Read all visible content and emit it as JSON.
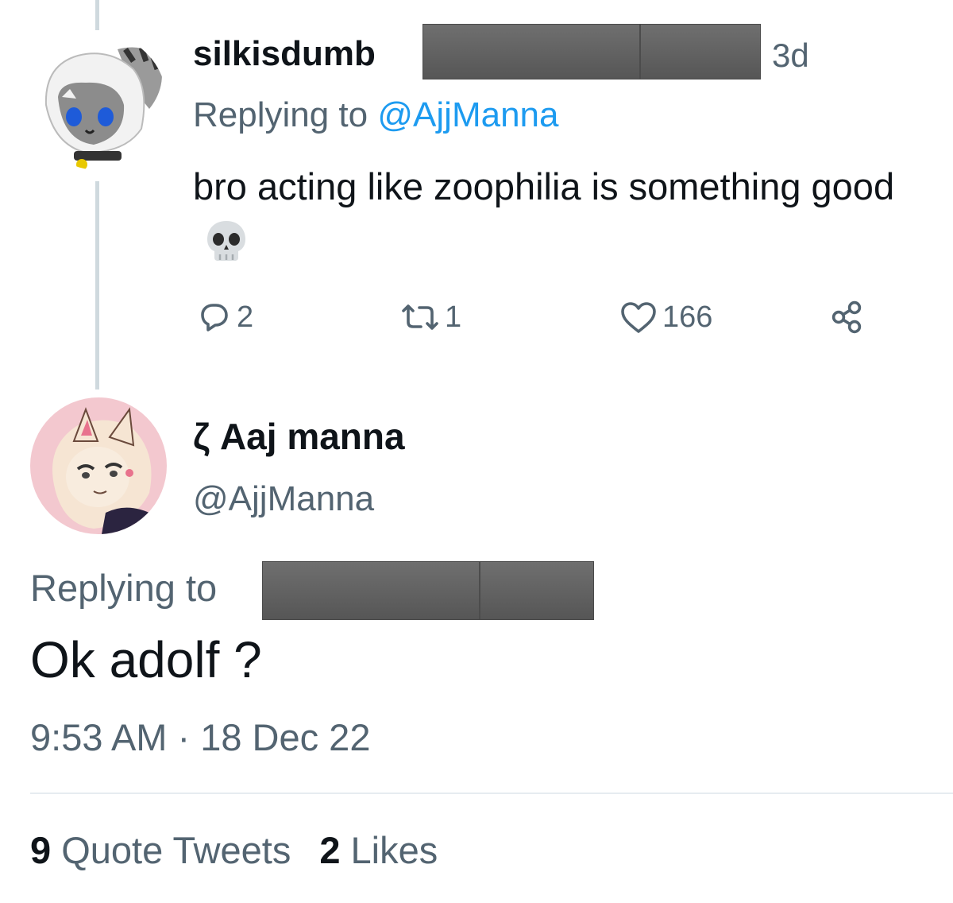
{
  "reply_tweet": {
    "author_name": "silkisdumb",
    "time_ago": "3d",
    "replying_prefix": "Replying to",
    "replying_mention": "@AjjManna",
    "text": "bro acting like zoophilia is something good",
    "emoji": "skull-emoji",
    "actions": {
      "reply_count": "2",
      "retweet_count": "1",
      "like_count": "166"
    }
  },
  "main_tweet": {
    "author_name": "ζ Aaj manna",
    "handle": "@AjjManna",
    "replying_prefix": "Replying to",
    "text": "Ok adolf ?",
    "timestamp": "9:53 AM · 18 Dec 22",
    "quote_count": "9",
    "quote_label": "Quote Tweets",
    "likes_count": "2",
    "likes_label": "Likes"
  },
  "colors": {
    "text": "#0f1419",
    "secondary": "#536471",
    "link": "#1d9bf0",
    "redaction": "#626262",
    "divider": "#e6ecf0"
  }
}
